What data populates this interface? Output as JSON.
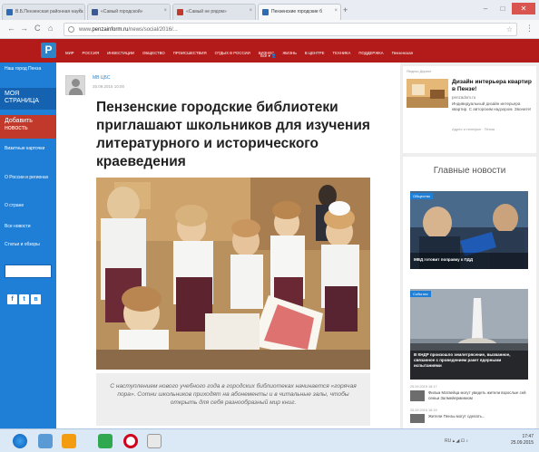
{
  "browser": {
    "tabs": [
      {
        "label": "В.Б.Пензенская районная наука"
      },
      {
        "label": "«Самый городской»"
      },
      {
        "label": "«Самый не рядом»"
      },
      {
        "label": "Пензенские городские б"
      }
    ],
    "url_prefix": "www.",
    "url_domain": "penzainform.ru",
    "url_path": "/news/social/2016/...",
    "new_tab_label": "+",
    "back": "←",
    "forward": "→",
    "reload": "C",
    "home": "⌂",
    "menu": "⋮",
    "star": "☆",
    "win_min": "–",
    "win_max": "□",
    "win_close": "✕"
  },
  "site": {
    "logo": "P",
    "nav": [
      "МИР",
      "РОССИЯ",
      "ИНВЕСТИЦИИ",
      "ОБЩЕСТВО",
      "ПРОИСШЕСТВИЯ",
      "ОТДЫХ В РОССИИ",
      "БИЗНЕС",
      "ЖИЗНЬ",
      "В ЦЕНТРЕ",
      "ТЕХНИКА",
      "ПОДДЕРЖКА",
      "Пензенская"
    ],
    "nav_sub": "Всё ▾ 👤"
  },
  "sidebar": {
    "top_link": "Наш город Пенза",
    "my_page": "МОЯ СТРАНИЦА",
    "add_news": "Добавить новость",
    "items": [
      "Визитные карточки",
      "О России и регионах",
      "О стране",
      "Все новости",
      "Статьи и обзоры"
    ],
    "social": [
      "f",
      "t",
      "в"
    ]
  },
  "article": {
    "author": "МВ ЦБС",
    "date": "25.09.2015 10:00",
    "title": "Пензенские городские библиотеки приглашают школьников для изучения литературного и исторического краеведения",
    "caption": "С наступлением нового учебного года в городских библиотеках начинается «горячая пора». Сотни школьников приходят на абонементы и в читальные залы, чтобы открыть для себя разнообразный мир книг."
  },
  "ad": {
    "label": "Яндекс.Директ",
    "title": "Дизайн интерьера квартир в Пензе!",
    "domain": "penzadom.ru",
    "text": "Индивидуальный дизайн интерьера квартир. С авторским надзором. Звоните!",
    "meta": "Адрес и телефон · Пенза"
  },
  "news": {
    "heading": "Главные новости",
    "items": [
      {
        "tag": "Общество",
        "caption": "МВД готовит поправку к ПДД"
      },
      {
        "tag": "События",
        "caption": "В КНДР произошло землетрясение, вызванное, связанное с проведением ракет ядерными испытаниями"
      }
    ],
    "small": [
      {
        "date": "25.09.2015 18:17",
        "text": "Фильм Матвейца могут увидеть жители взрослые сей семьи Залмейерминиом"
      },
      {
        "date": "25.09.2015 18:15",
        "text": "Жители Пензы могут сделать..."
      }
    ]
  },
  "taskbar": {
    "time": "17:47",
    "date": "25.09.2015",
    "tray": "RU ▴ ◢ ⊡ ♪"
  }
}
